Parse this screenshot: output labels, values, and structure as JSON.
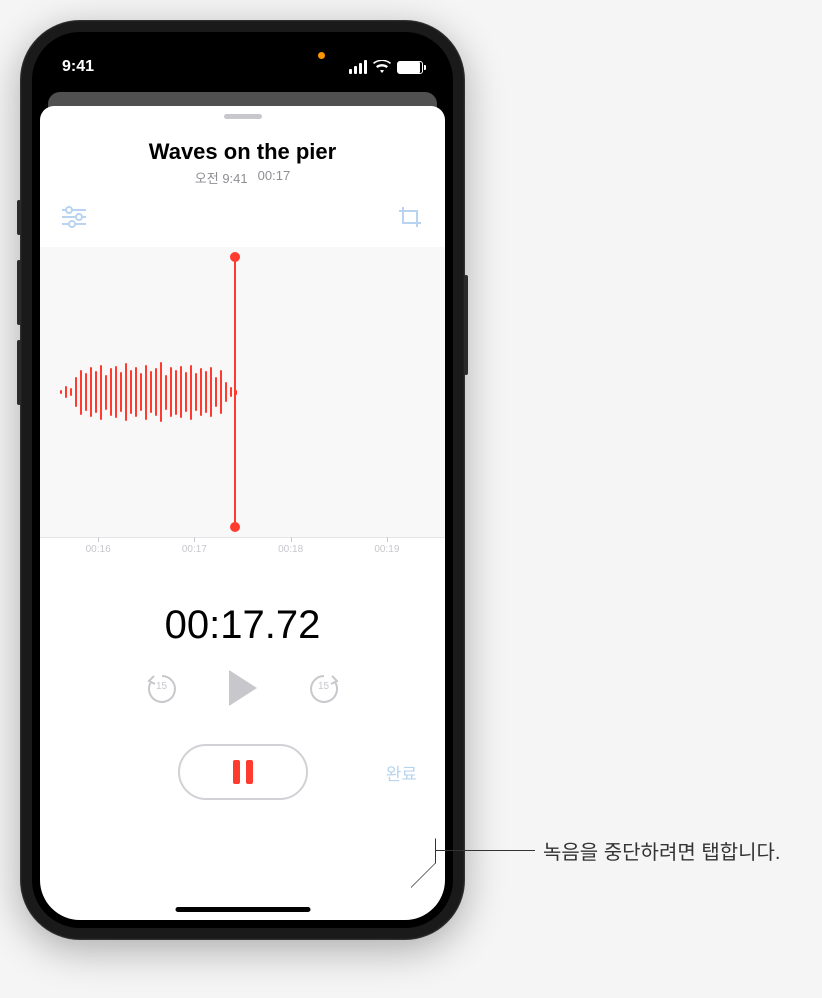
{
  "status": {
    "time": "9:41"
  },
  "recording": {
    "title": "Waves on the pier",
    "time_label": "오전 9:41",
    "duration": "00:17"
  },
  "ruler": {
    "t0": "00:16",
    "t1": "00:17",
    "t2": "00:18",
    "t3": "00:19"
  },
  "elapsed": "00:17.72",
  "skip": {
    "back": "15",
    "forward": "15"
  },
  "done_label": "완료",
  "callout": "녹음을 중단하려면 탭합니다."
}
